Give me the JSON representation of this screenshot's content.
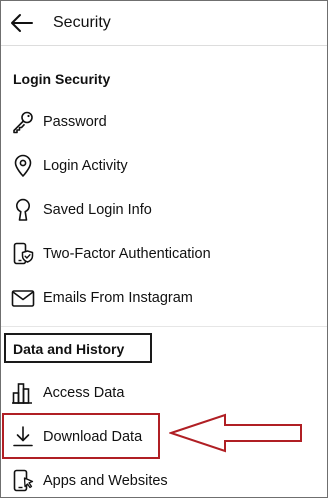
{
  "header": {
    "title": "Security",
    "back_icon": "arrow-left-icon"
  },
  "login_security": {
    "title": "Login Security",
    "items": [
      {
        "label": "Password",
        "icon": "key-icon"
      },
      {
        "label": "Login Activity",
        "icon": "location-pin-icon"
      },
      {
        "label": "Saved Login Info",
        "icon": "keyhole-icon"
      },
      {
        "label": "Two-Factor Authentication",
        "icon": "phone-shield-icon"
      },
      {
        "label": "Emails From Instagram",
        "icon": "envelope-icon"
      }
    ]
  },
  "data_history": {
    "title": "Data and History",
    "items": [
      {
        "label": "Access Data",
        "icon": "bar-chart-icon"
      },
      {
        "label": "Download Data",
        "icon": "download-icon"
      },
      {
        "label": "Apps and Websites",
        "icon": "phone-cursor-icon"
      }
    ]
  },
  "annotation": {
    "highlight_color": "#b01f24",
    "box_color": "#1a1a1a"
  }
}
